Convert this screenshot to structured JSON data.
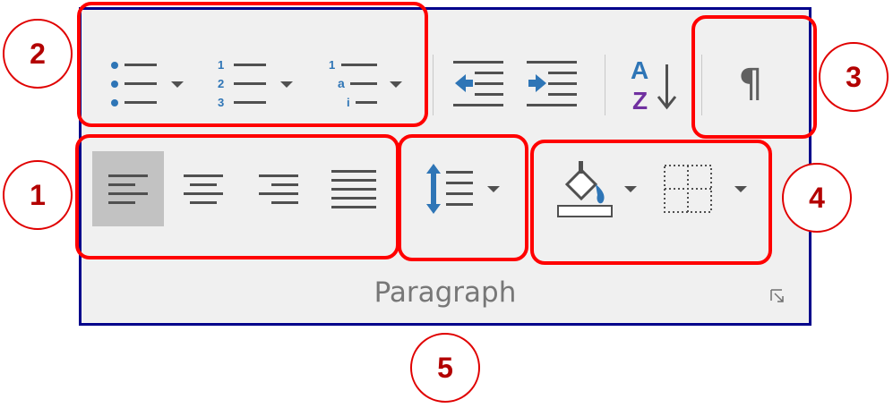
{
  "group": {
    "label": "Paragraph"
  },
  "callouts": [
    "1",
    "2",
    "3",
    "4",
    "5"
  ],
  "colors": {
    "panel_border": "#00008b",
    "panel_bg": "#f0f0f0",
    "highlight_box": "#ff0000",
    "callout_text": "#b30000",
    "icon_blue": "#2e75b6",
    "icon_gray": "#505050",
    "sort_purple": "#7030a0"
  },
  "buttons": [
    {
      "name": "bullets-button",
      "icon": "bullet-list-icon",
      "dropdown": true
    },
    {
      "name": "numbering-button",
      "icon": "numbered-list-icon",
      "dropdown": true
    },
    {
      "name": "multilevel-list-button",
      "icon": "multilevel-list-icon",
      "dropdown": true
    },
    {
      "name": "decrease-indent-button",
      "icon": "decrease-indent-icon",
      "dropdown": false
    },
    {
      "name": "increase-indent-button",
      "icon": "increase-indent-icon",
      "dropdown": false
    },
    {
      "name": "sort-button",
      "icon": "sort-az-icon",
      "dropdown": false
    },
    {
      "name": "show-hide-button",
      "icon": "pilcrow-icon",
      "dropdown": false
    },
    {
      "name": "align-left-button",
      "icon": "align-left-icon",
      "dropdown": false,
      "selected": true
    },
    {
      "name": "center-button",
      "icon": "align-center-icon",
      "dropdown": false
    },
    {
      "name": "align-right-button",
      "icon": "align-right-icon",
      "dropdown": false
    },
    {
      "name": "justify-button",
      "icon": "justify-icon",
      "dropdown": false
    },
    {
      "name": "line-spacing-button",
      "icon": "line-spacing-icon",
      "dropdown": true
    },
    {
      "name": "shading-button",
      "icon": "paint-bucket-icon",
      "dropdown": true
    },
    {
      "name": "borders-button",
      "icon": "borders-icon",
      "dropdown": true
    },
    {
      "name": "paragraph-settings-launcher",
      "icon": "dialog-launcher-icon",
      "dropdown": false
    }
  ]
}
